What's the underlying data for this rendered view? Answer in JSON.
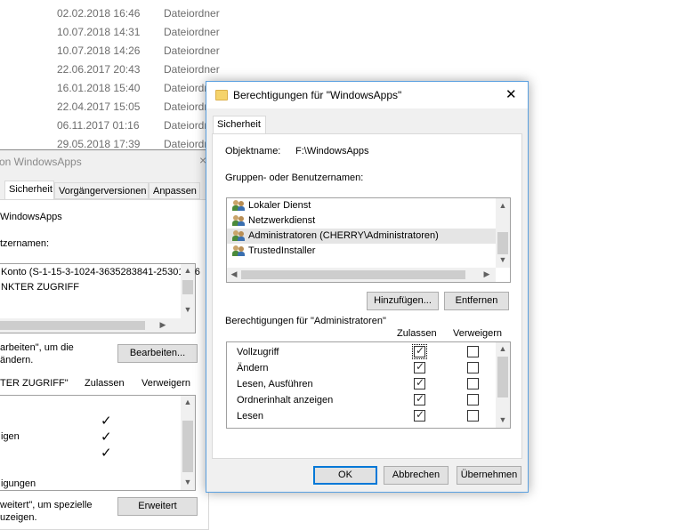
{
  "explorer_rows": [
    {
      "date": "02.02.2018 16:46",
      "type": "Dateiordner"
    },
    {
      "date": "10.07.2018 14:31",
      "type": "Dateiordner"
    },
    {
      "date": "10.07.2018 14:26",
      "type": "Dateiordner"
    },
    {
      "date": "22.06.2017 20:43",
      "type": "Dateiordner"
    },
    {
      "date": "16.01.2018 15:40",
      "type": "Dateiordner"
    },
    {
      "date": "22.04.2017 15:05",
      "type": "Dateiordner"
    },
    {
      "date": "06.11.2017 01:16",
      "type": "Dateiordner"
    },
    {
      "date": "29.05.2018 17:39",
      "type": "Dateiordner"
    }
  ],
  "back_dialog": {
    "title": "on WindowsApps",
    "close": "×",
    "tabs": [
      "Sicherheit",
      "Vorgängerversionen",
      "Anpassen"
    ],
    "object_value": "WindowsApps",
    "group_label": "tzernamen:",
    "list_items": [
      "Konto (S-1-15-3-1024-3635283841-25301826",
      "NKTER ZUGRIFF"
    ],
    "edit_text_1": "arbeiten\", um die",
    "edit_text_2": "ändern.",
    "edit_button": "Bearbeiten...",
    "perm_header": "TER ZUGRIFF\"",
    "col_allow": "Zulassen",
    "col_deny": "Verweigern",
    "perm_rows": [
      "",
      "igen",
      "",
      "",
      "igungen"
    ],
    "adv_text_1": "weitert\", um spezielle",
    "adv_text_2": "uzeigen.",
    "adv_button": "Erweitert"
  },
  "front_dialog": {
    "title": "Berechtigungen für \"WindowsApps\"",
    "close": "✕",
    "tab": "Sicherheit",
    "object_label": "Objektname:",
    "object_value": "F:\\WindowsApps",
    "groups_label": "Gruppen- oder Benutzernamen:",
    "users": [
      {
        "name": "Lokaler Dienst",
        "selected": false
      },
      {
        "name": "Netzwerkdienst",
        "selected": false
      },
      {
        "name": "Administratoren (CHERRY\\Administratoren)",
        "selected": true
      },
      {
        "name": "TrustedInstaller",
        "selected": false
      }
    ],
    "add_button": "Hinzufügen...",
    "remove_button": "Entfernen",
    "perms_label": "Berechtigungen für \"Administratoren\"",
    "col_allow": "Zulassen",
    "col_deny": "Verweigern",
    "permissions": [
      {
        "name": "Vollzugriff",
        "allow": true,
        "deny": false
      },
      {
        "name": "Ändern",
        "allow": true,
        "deny": false
      },
      {
        "name": "Lesen, Ausführen",
        "allow": true,
        "deny": false
      },
      {
        "name": "Ordnerinhalt anzeigen",
        "allow": true,
        "deny": false
      },
      {
        "name": "Lesen",
        "allow": true,
        "deny": false
      }
    ],
    "ok_button": "OK",
    "cancel_button": "Abbrechen",
    "apply_button": "Übernehmen"
  },
  "colors": {
    "accent": "#0078d7",
    "selected_row": "#e5e5e5"
  }
}
